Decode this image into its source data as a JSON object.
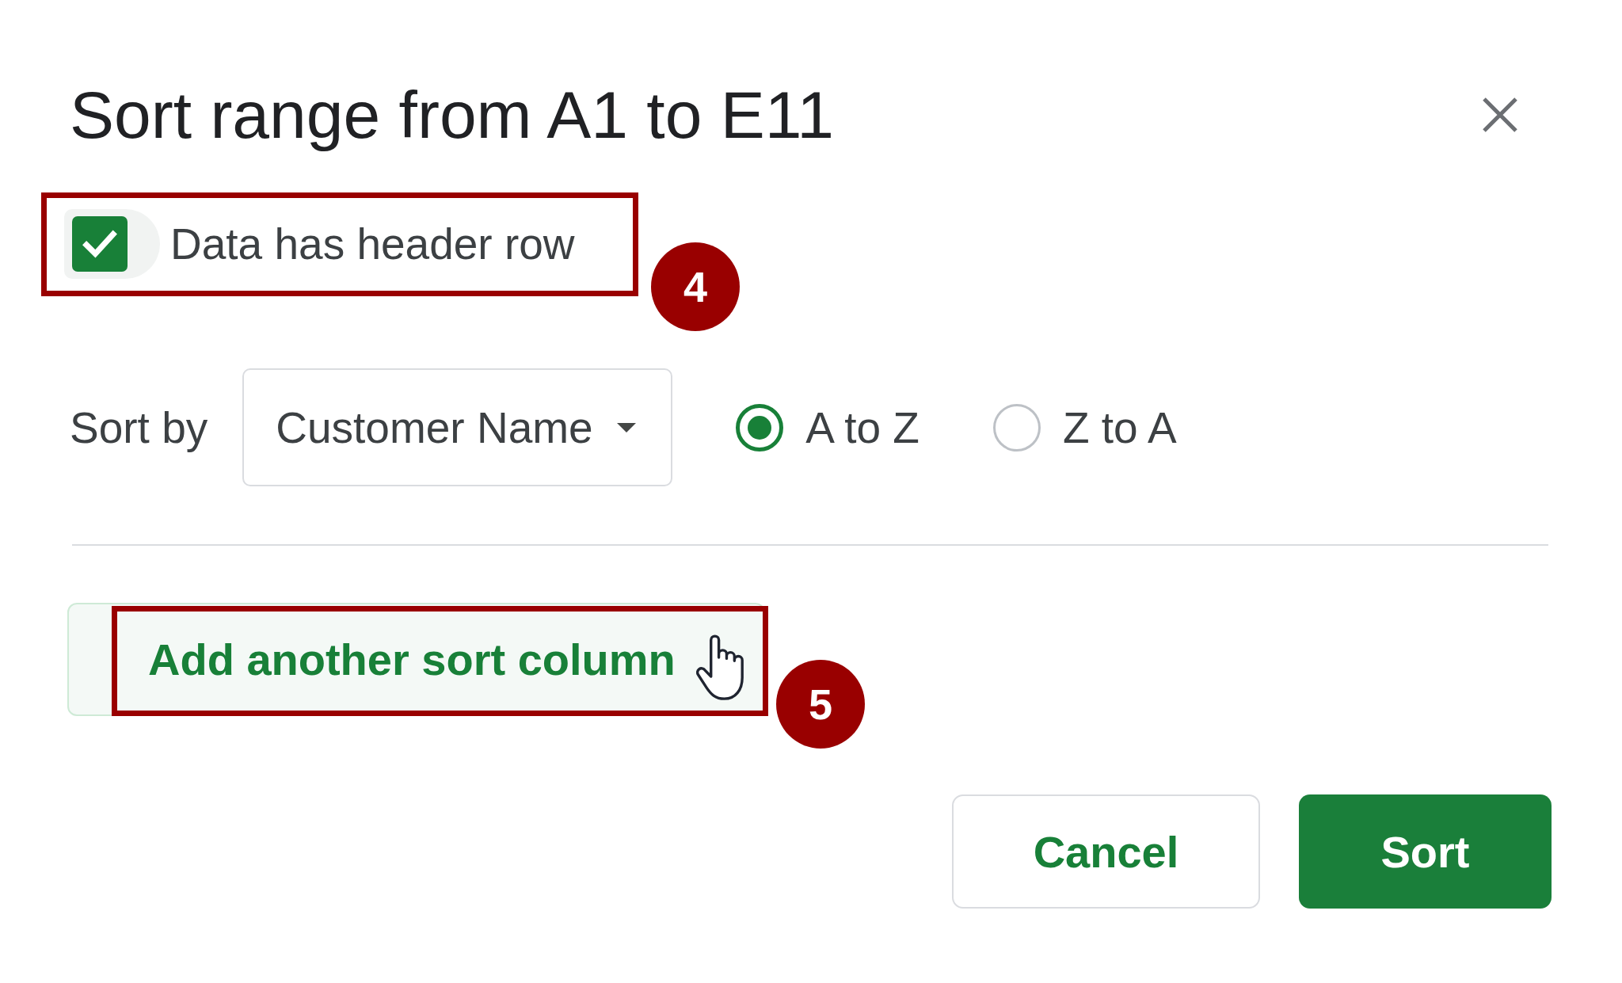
{
  "dialog": {
    "title": "Sort range from A1 to E11"
  },
  "header_checkbox": {
    "label": "Data has header row",
    "checked": true,
    "highlighted": true,
    "callout": "4"
  },
  "sort_rule": {
    "label": "Sort by",
    "column": "Customer Name",
    "orders": [
      {
        "label": "A to Z",
        "selected": true
      },
      {
        "label": "Z to A",
        "selected": false
      }
    ]
  },
  "add_sort_column": {
    "label": "Add another sort column",
    "highlighted": true,
    "callout": "5"
  },
  "buttons": [
    {
      "label": "Cancel",
      "kind": "secondary"
    },
    {
      "label": "Sort",
      "kind": "primary"
    }
  ]
}
